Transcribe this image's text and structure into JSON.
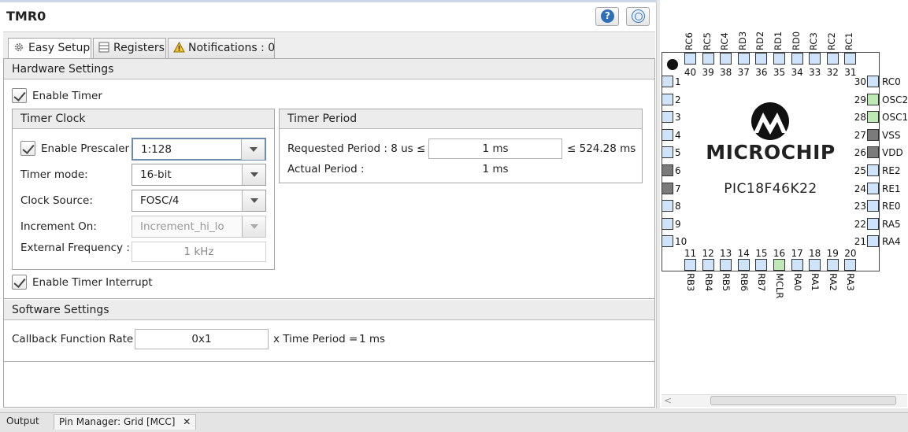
{
  "window": {
    "title": "TMR0"
  },
  "header": {
    "help_glyph": "?",
    "help_icon": "help-icon",
    "web_icon": "globe-icon"
  },
  "tabs": [
    {
      "label": "Easy Setup",
      "icon": "gear-icon",
      "active": true
    },
    {
      "label": "Registers",
      "icon": "table-icon",
      "active": false
    },
    {
      "label": "Notifications : 0",
      "icon": "warning-icon",
      "active": false
    }
  ],
  "hardware": {
    "title": "Hardware Settings",
    "enable_timer": {
      "label": "Enable Timer",
      "checked": true
    },
    "timer_clock": {
      "title": "Timer Clock",
      "enable_prescaler": {
        "label": "Enable Prescaler",
        "checked": true,
        "value": "1:128"
      },
      "timer_mode": {
        "label": "Timer mode:",
        "value": "16-bit"
      },
      "clock_source": {
        "label": "Clock Source:",
        "value": "FOSC/4"
      },
      "increment_on": {
        "label": "Increment On:",
        "value": "Increment_hi_lo",
        "disabled": true
      },
      "external_frequency": {
        "label": "External Frequency :",
        "value": "1 kHz",
        "disabled": true
      }
    },
    "timer_period": {
      "title": "Timer Period",
      "requested_label": "Requested Period : 8 us ≤",
      "requested_value": "1 ms",
      "requested_max": "≤ 524.28 ms",
      "actual_label": "Actual Period :",
      "actual_value": "1 ms"
    },
    "enable_interrupt": {
      "label": "Enable Timer Interrupt",
      "checked": true
    }
  },
  "software": {
    "title": "Software Settings",
    "callback_label": "Callback Function Rate",
    "callback_value": "0x1",
    "callback_suffix": "x Time Period =",
    "callback_result": "1 ms"
  },
  "chip": {
    "brand": "MICROCHIP",
    "part": "PIC18F46K22",
    "logo_icon": "microchip-logo",
    "top_pins": [
      {
        "name": "RC6",
        "num": "40",
        "state": "normal"
      },
      {
        "name": "RC5",
        "num": "39",
        "state": "normal"
      },
      {
        "name": "RC4",
        "num": "38",
        "state": "normal"
      },
      {
        "name": "RD3",
        "num": "37",
        "state": "normal"
      },
      {
        "name": "RD2",
        "num": "36",
        "state": "normal"
      },
      {
        "name": "RD1",
        "num": "35",
        "state": "normal"
      },
      {
        "name": "RD0",
        "num": "34",
        "state": "normal"
      },
      {
        "name": "RC3",
        "num": "33",
        "state": "normal"
      },
      {
        "name": "RC2",
        "num": "32",
        "state": "normal"
      },
      {
        "name": "RC1",
        "num": "31",
        "state": "normal"
      }
    ],
    "left_pins": [
      {
        "num": "1",
        "state": "normal"
      },
      {
        "num": "2",
        "state": "normal"
      },
      {
        "num": "3",
        "state": "normal"
      },
      {
        "num": "4",
        "state": "normal"
      },
      {
        "num": "5",
        "state": "normal"
      },
      {
        "num": "6",
        "state": "power"
      },
      {
        "num": "7",
        "state": "power"
      },
      {
        "num": "8",
        "state": "normal"
      },
      {
        "num": "9",
        "state": "normal"
      },
      {
        "num": "10",
        "state": "normal"
      }
    ],
    "right_pins": [
      {
        "num": "30",
        "name": "RC0",
        "state": "normal"
      },
      {
        "num": "29",
        "name": "OSC2",
        "state": "used"
      },
      {
        "num": "28",
        "name": "OSC1",
        "state": "used"
      },
      {
        "num": "27",
        "name": "VSS",
        "state": "power"
      },
      {
        "num": "26",
        "name": "VDD",
        "state": "power"
      },
      {
        "num": "25",
        "name": "RE2",
        "state": "normal"
      },
      {
        "num": "24",
        "name": "RE1",
        "state": "normal"
      },
      {
        "num": "23",
        "name": "RE0",
        "state": "normal"
      },
      {
        "num": "22",
        "name": "RA5",
        "state": "normal"
      },
      {
        "num": "21",
        "name": "RA4",
        "state": "normal"
      }
    ],
    "bottom_pins": [
      {
        "num": "11",
        "name": "RB3",
        "state": "normal"
      },
      {
        "num": "12",
        "name": "RB4",
        "state": "normal"
      },
      {
        "num": "13",
        "name": "RB5",
        "state": "normal"
      },
      {
        "num": "14",
        "name": "RB6",
        "state": "normal"
      },
      {
        "num": "15",
        "name": "RB7",
        "state": "normal"
      },
      {
        "num": "16",
        "name": "MCLR",
        "state": "used"
      },
      {
        "num": "17",
        "name": "RA0",
        "state": "normal"
      },
      {
        "num": "18",
        "name": "RA1",
        "state": "normal"
      },
      {
        "num": "19",
        "name": "RA2",
        "state": "normal"
      },
      {
        "num": "20",
        "name": "RA3",
        "state": "normal"
      }
    ]
  },
  "bottom_tabs": [
    {
      "label": "Output",
      "closable": false
    },
    {
      "label": "Pin Manager: Grid [MCC]",
      "closable": true
    }
  ],
  "close_glyph": "✕",
  "colors": {
    "pin_normal": "#cfe3fb",
    "pin_used": "#bfe8b7",
    "pin_power": "#7b7b7b",
    "accent": "#2f6fb7"
  }
}
